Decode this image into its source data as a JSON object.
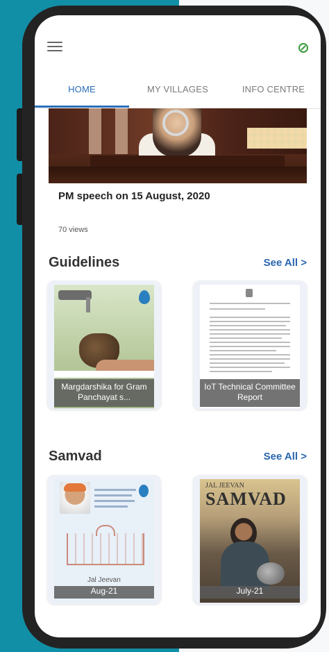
{
  "tabs": [
    {
      "label": "HOME",
      "active": true
    },
    {
      "label": "MY VILLAGES",
      "active": false
    },
    {
      "label": "INFO CENTRE",
      "active": false
    }
  ],
  "video": {
    "title": "PM speech on 15 August, 2020",
    "views": "70 views"
  },
  "guidelines": {
    "title": "Guidelines",
    "see_all": "See All >",
    "items": [
      {
        "caption": "Margdarshika for Gram Panchayat s..."
      },
      {
        "caption": "IoT Technical Committee Report"
      }
    ]
  },
  "samvad": {
    "title": "Samvad",
    "see_all": "See All >",
    "items": [
      {
        "caption": "Aug-21",
        "cover_text": "Jal Jeevan"
      },
      {
        "caption": "July-21",
        "masthead_top": "JAL JEEVAN",
        "masthead": "SAMVAD"
      }
    ]
  },
  "colors": {
    "accent": "#2a6fb8",
    "background_left": "#118fa6",
    "icon_green": "#3a9a3a"
  },
  "icons": {
    "menu": "hamburger-menu-icon",
    "status": "leaf-icon"
  }
}
